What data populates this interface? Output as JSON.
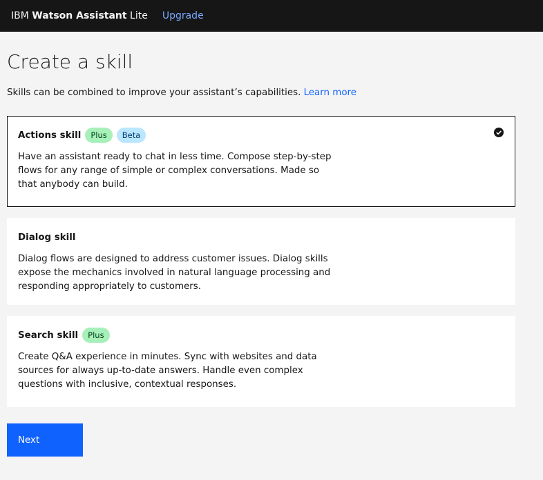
{
  "header": {
    "brand_ibm": "IBM ",
    "brand_product": "Watson Assistant",
    "brand_plan": " Lite",
    "upgrade_label": "Upgrade"
  },
  "page": {
    "title": "Create a skill",
    "subtitle": "Skills can be combined to improve your assistant’s capabilities.",
    "learn_more": "Learn more"
  },
  "skills": [
    {
      "title": "Actions skill",
      "tags": [
        "Plus",
        "Beta"
      ],
      "description": "Have an assistant ready to chat in less time. Compose step-by-step flows for any range of simple or complex conversations. Made so that anybody can build.",
      "selected": true
    },
    {
      "title": "Dialog skill",
      "tags": [],
      "description": "Dialog flows are designed to address customer issues. Dialog skills expose the mechanics involved in natural language processing and responding appropriately to customers.",
      "selected": false
    },
    {
      "title": "Search skill",
      "tags": [
        "Plus"
      ],
      "description": "Create Q&A experience in minutes. Sync with websites and data sources for always up-to-date answers. Handle even complex questions with inclusive, contextual responses.",
      "selected": false
    }
  ],
  "actions": {
    "next_label": "Next"
  },
  "icons": {
    "selected": "checkmark-filled-icon"
  },
  "colors": {
    "primary": "#0f62fe",
    "topbar": "#161616",
    "link_on_dark": "#78a9ff",
    "tag_plus_bg": "#a7f0ba",
    "tag_beta_bg": "#bae6ff"
  }
}
